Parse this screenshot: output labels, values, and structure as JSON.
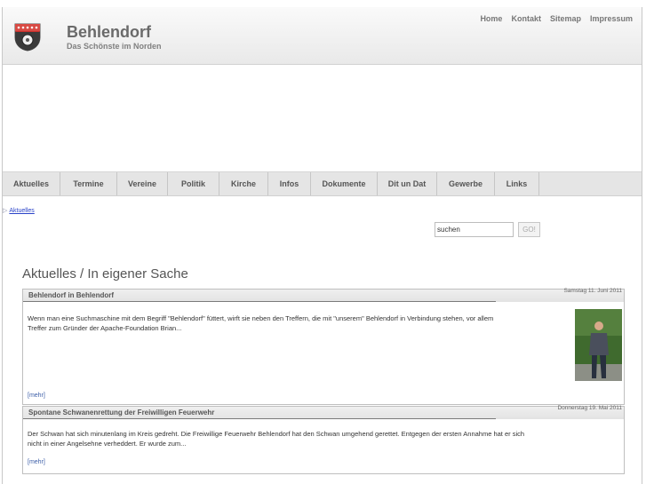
{
  "header": {
    "title": "Behlendorf",
    "subtitle": "Das Schönste im Norden",
    "topnav": [
      "Home",
      "Kontakt",
      "Sitemap",
      "Impressum"
    ]
  },
  "mainnav": [
    "Aktuelles",
    "Termine",
    "Vereine",
    "Politik",
    "Kirche",
    "Infos",
    "Dokumente",
    "Dit un Dat",
    "Gewerbe",
    "Links"
  ],
  "breadcrumb": {
    "item": "Aktuelles"
  },
  "search": {
    "value": "suchen",
    "button": "GO!"
  },
  "page_title": "Aktuelles / In eigener Sache",
  "articles": [
    {
      "title": "Behlendorf in Behlendorf",
      "date": "Samstag 11. Juni 2011",
      "line1": "Wenn man eine Suchmaschine mit dem Begriff \"Behlendorf\" füttert, wirft sie neben den Treffern, die mit \"unserem\" Behlendorf in Verbindung stehen, vor allem",
      "line2": "Treffer zum Gründer der Apache-Foundation Brian...",
      "more": "[mehr]"
    },
    {
      "title": "Spontane Schwanenrettung der Freiwilligen Feuerwehr",
      "date": "Donnerstag 19. Mai 2011",
      "line1": "Der Schwan hat sich minutenlang im Kreis gedreht. Die Freiwillige Feuerwehr Behlendorf hat den Schwan umgehend gerettet. Entgegen der ersten Annahme hat er sich",
      "line2": "nicht in einer Angelsehne verheddert. Er wurde zum...",
      "more": "[mehr]"
    }
  ]
}
